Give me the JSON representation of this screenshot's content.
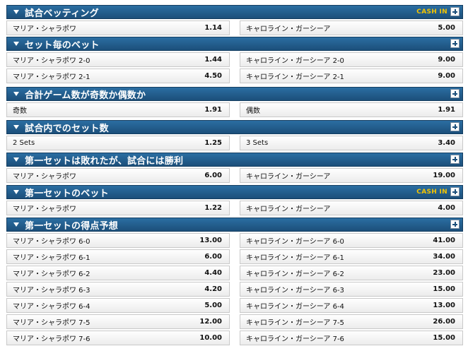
{
  "markets": [
    {
      "title": "試合ベッティング",
      "cash_in": "CASH IN",
      "rows": [
        [
          {
            "name": "マリア・シャラポワ",
            "odds": "1.14"
          },
          {
            "name": "キャロライン・ガーシーア",
            "odds": "5.00"
          }
        ]
      ]
    },
    {
      "title": "セット毎のベット",
      "cash_in": "",
      "rows": [
        [
          {
            "name": "マリア・シャラポワ 2-0",
            "odds": "1.44"
          },
          {
            "name": "キャロライン・ガーシーア 2-0",
            "odds": "9.00"
          }
        ],
        [
          {
            "name": "マリア・シャラポワ 2-1",
            "odds": "4.50"
          },
          {
            "name": "キャロライン・ガーシーア 2-1",
            "odds": "9.00"
          }
        ]
      ]
    },
    {
      "title": "合計ゲーム数が奇数か偶数か",
      "cash_in": "",
      "rows": [
        [
          {
            "name": "奇数",
            "odds": "1.91"
          },
          {
            "name": "偶数",
            "odds": "1.91"
          }
        ]
      ]
    },
    {
      "title": "試合内でのセット数",
      "cash_in": "",
      "rows": [
        [
          {
            "name": "2 Sets",
            "odds": "1.25"
          },
          {
            "name": "3 Sets",
            "odds": "3.40"
          }
        ]
      ]
    },
    {
      "title": "第一セットは敗れたが、試合には勝利",
      "cash_in": "",
      "rows": [
        [
          {
            "name": "マリア・シャラポワ",
            "odds": "6.00"
          },
          {
            "name": "キャロライン・ガーシーア",
            "odds": "19.00"
          }
        ]
      ]
    },
    {
      "title": "第一セットのベット",
      "cash_in": "CASH IN",
      "rows": [
        [
          {
            "name": "マリア・シャラポワ",
            "odds": "1.22"
          },
          {
            "name": "キャロライン・ガーシーア",
            "odds": "4.00"
          }
        ]
      ]
    },
    {
      "title": "第一セットの得点予想",
      "cash_in": "",
      "rows": [
        [
          {
            "name": "マリア・シャラポワ 6-0",
            "odds": "13.00"
          },
          {
            "name": "キャロライン・ガーシーア 6-0",
            "odds": "41.00"
          }
        ],
        [
          {
            "name": "マリア・シャラポワ 6-1",
            "odds": "6.00"
          },
          {
            "name": "キャロライン・ガーシーア 6-1",
            "odds": "34.00"
          }
        ],
        [
          {
            "name": "マリア・シャラポワ 6-2",
            "odds": "4.40"
          },
          {
            "name": "キャロライン・ガーシーア 6-2",
            "odds": "23.00"
          }
        ],
        [
          {
            "name": "マリア・シャラポワ 6-3",
            "odds": "4.20"
          },
          {
            "name": "キャロライン・ガーシーア 6-3",
            "odds": "15.00"
          }
        ],
        [
          {
            "name": "マリア・シャラポワ 6-4",
            "odds": "5.00"
          },
          {
            "name": "キャロライン・ガーシーア 6-4",
            "odds": "13.00"
          }
        ],
        [
          {
            "name": "マリア・シャラポワ 7-5",
            "odds": "12.00"
          },
          {
            "name": "キャロライン・ガーシーア 7-5",
            "odds": "26.00"
          }
        ],
        [
          {
            "name": "マリア・シャラポワ 7-6",
            "odds": "10.00"
          },
          {
            "name": "キャロライン・ガーシーア 7-6",
            "odds": "15.00"
          }
        ]
      ]
    }
  ]
}
